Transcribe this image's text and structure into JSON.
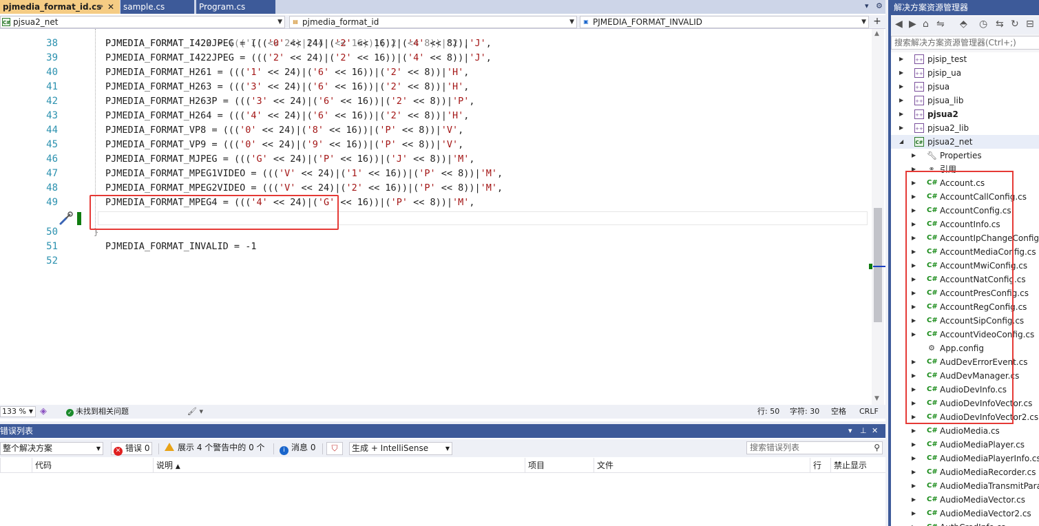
{
  "tabs": [
    {
      "label": "pjmedia_format_id.cs",
      "active": true,
      "pin": "⇒",
      "close": "✕"
    },
    {
      "label": "sample.cs",
      "active": false
    },
    {
      "label": "Program.cs",
      "active": false
    }
  ],
  "navbar": {
    "project": "pjsua2_net",
    "type": "pjmedia_format_id",
    "member": "PJMEDIA_FORMAT_INVALID",
    "project_icon": "C#"
  },
  "code_lines": [
    {
      "n": "38",
      "name": "PJMEDIA_FORMAT_I420JPEG",
      "a": "'0'",
      "b": "'2'",
      "c": "'4'",
      "d": "'J'",
      "tail": ","
    },
    {
      "n": "39",
      "name": "PJMEDIA_FORMAT_I422JPEG",
      "a": "'2'",
      "b": "'2'",
      "c": "'4'",
      "d": "'J'",
      "tail": ","
    },
    {
      "n": "40",
      "name": "PJMEDIA_FORMAT_H261",
      "a": "'1'",
      "b": "'6'",
      "c": "'2'",
      "d": "'H'",
      "tail": ","
    },
    {
      "n": "41",
      "name": "PJMEDIA_FORMAT_H263",
      "a": "'3'",
      "b": "'6'",
      "c": "'2'",
      "d": "'H'",
      "tail": ","
    },
    {
      "n": "42",
      "name": "PJMEDIA_FORMAT_H263P",
      "a": "'3'",
      "b": "'6'",
      "c": "'2'",
      "d": "'P'",
      "tail": ","
    },
    {
      "n": "43",
      "name": "PJMEDIA_FORMAT_H264",
      "a": "'4'",
      "b": "'6'",
      "c": "'2'",
      "d": "'H'",
      "tail": ","
    },
    {
      "n": "44",
      "name": "PJMEDIA_FORMAT_VP8",
      "a": "'0'",
      "b": "'8'",
      "c": "'P'",
      "d": "'V'",
      "tail": ","
    },
    {
      "n": "45",
      "name": "PJMEDIA_FORMAT_VP9",
      "a": "'0'",
      "b": "'9'",
      "c": "'P'",
      "d": "'V'",
      "tail": ","
    },
    {
      "n": "46",
      "name": "PJMEDIA_FORMAT_MJPEG",
      "a": "'G'",
      "b": "'P'",
      "c": "'J'",
      "d": "'M'",
      "tail": ","
    },
    {
      "n": "47",
      "name": "PJMEDIA_FORMAT_MPEG1VIDEO",
      "a": "'V'",
      "b": "'1'",
      "c": "'P'",
      "d": "'M'",
      "tail": ","
    },
    {
      "n": "48",
      "name": "PJMEDIA_FORMAT_MPEG2VIDEO",
      "a": "'V'",
      "b": "'2'",
      "c": "'P'",
      "d": "'M'",
      "tail": ","
    },
    {
      "n": "49",
      "name": "PJMEDIA_FORMAT_MPEG4",
      "a": "'4'",
      "b": "'G'",
      "c": "'P'",
      "d": "'M'",
      "tail": ","
    }
  ],
  "line50": {
    "n": "50",
    "text": "PJMEDIA_FORMAT_INVALID = -1"
  },
  "line51": {
    "n": "51",
    "text": "}"
  },
  "line52": {
    "n": "52"
  },
  "line37_partial": "PJMEDIA_FORMAT_I422 = ((('I' << 24)|('4' << 16))|('2' << 8))|'2',",
  "editor_status": {
    "zoom": "133 %",
    "issues": "未找到相关问题",
    "line": "行: 50",
    "char": "字符: 30",
    "space": "空格",
    "eol": "CRLF"
  },
  "error_list": {
    "title": "错误列表",
    "scope": "整个解决方案",
    "errors": "错误 0",
    "warnings": "展示 4 个警告中的 0 个",
    "messages": "消息 0",
    "source": "生成 + IntelliSense",
    "search_placeholder": "搜索错误列表",
    "columns": [
      "代码",
      "说明",
      "项目",
      "文件",
      "行",
      "禁止显示"
    ]
  },
  "solution_explorer": {
    "title": "解决方案资源管理器",
    "search_placeholder": "搜索解决方案资源管理器(Ctrl+;)",
    "projects": [
      {
        "label": "pjsip_test",
        "bold": false
      },
      {
        "label": "pjsip_ua",
        "bold": false
      },
      {
        "label": "pjsua",
        "bold": false
      },
      {
        "label": "pjsua_lib",
        "bold": false
      },
      {
        "label": "pjsua2",
        "bold": true
      },
      {
        "label": "pjsua2_lib",
        "bold": false
      }
    ],
    "active_project": "pjsua2_net",
    "special": [
      {
        "label": "Properties",
        "icon": "wrench-icon"
      },
      {
        "label": "引用",
        "icon": "references-icon"
      }
    ],
    "files": [
      "Account.cs",
      "AccountCallConfig.cs",
      "AccountConfig.cs",
      "AccountInfo.cs",
      "AccountIpChangeConfig.cs",
      "AccountMediaConfig.cs",
      "AccountMwiConfig.cs",
      "AccountNatConfig.cs",
      "AccountPresConfig.cs",
      "AccountRegConfig.cs",
      "AccountSipConfig.cs",
      "AccountVideoConfig.cs",
      "App.config",
      "AudDevErrorEvent.cs",
      "AudDevManager.cs",
      "AudioDevInfo.cs",
      "AudioDevInfoVector.cs",
      "AudioDevInfoVector2.cs",
      "AudioMedia.cs",
      "AudioMediaPlayer.cs",
      "AudioMediaPlayerInfo.cs",
      "AudioMediaRecorder.cs",
      "AudioMediaTransmitParam.cs",
      "AudioMediaVector.cs",
      "AudioMediaVector2.cs",
      "AuthCredInfo.cs"
    ]
  },
  "colors": {
    "accent": "#3d5a99",
    "active_tab": "#f5cc84",
    "annotation": "#e53935",
    "string": "#a31515",
    "line_number": "#2b91af",
    "change_bar": "#107c10"
  }
}
